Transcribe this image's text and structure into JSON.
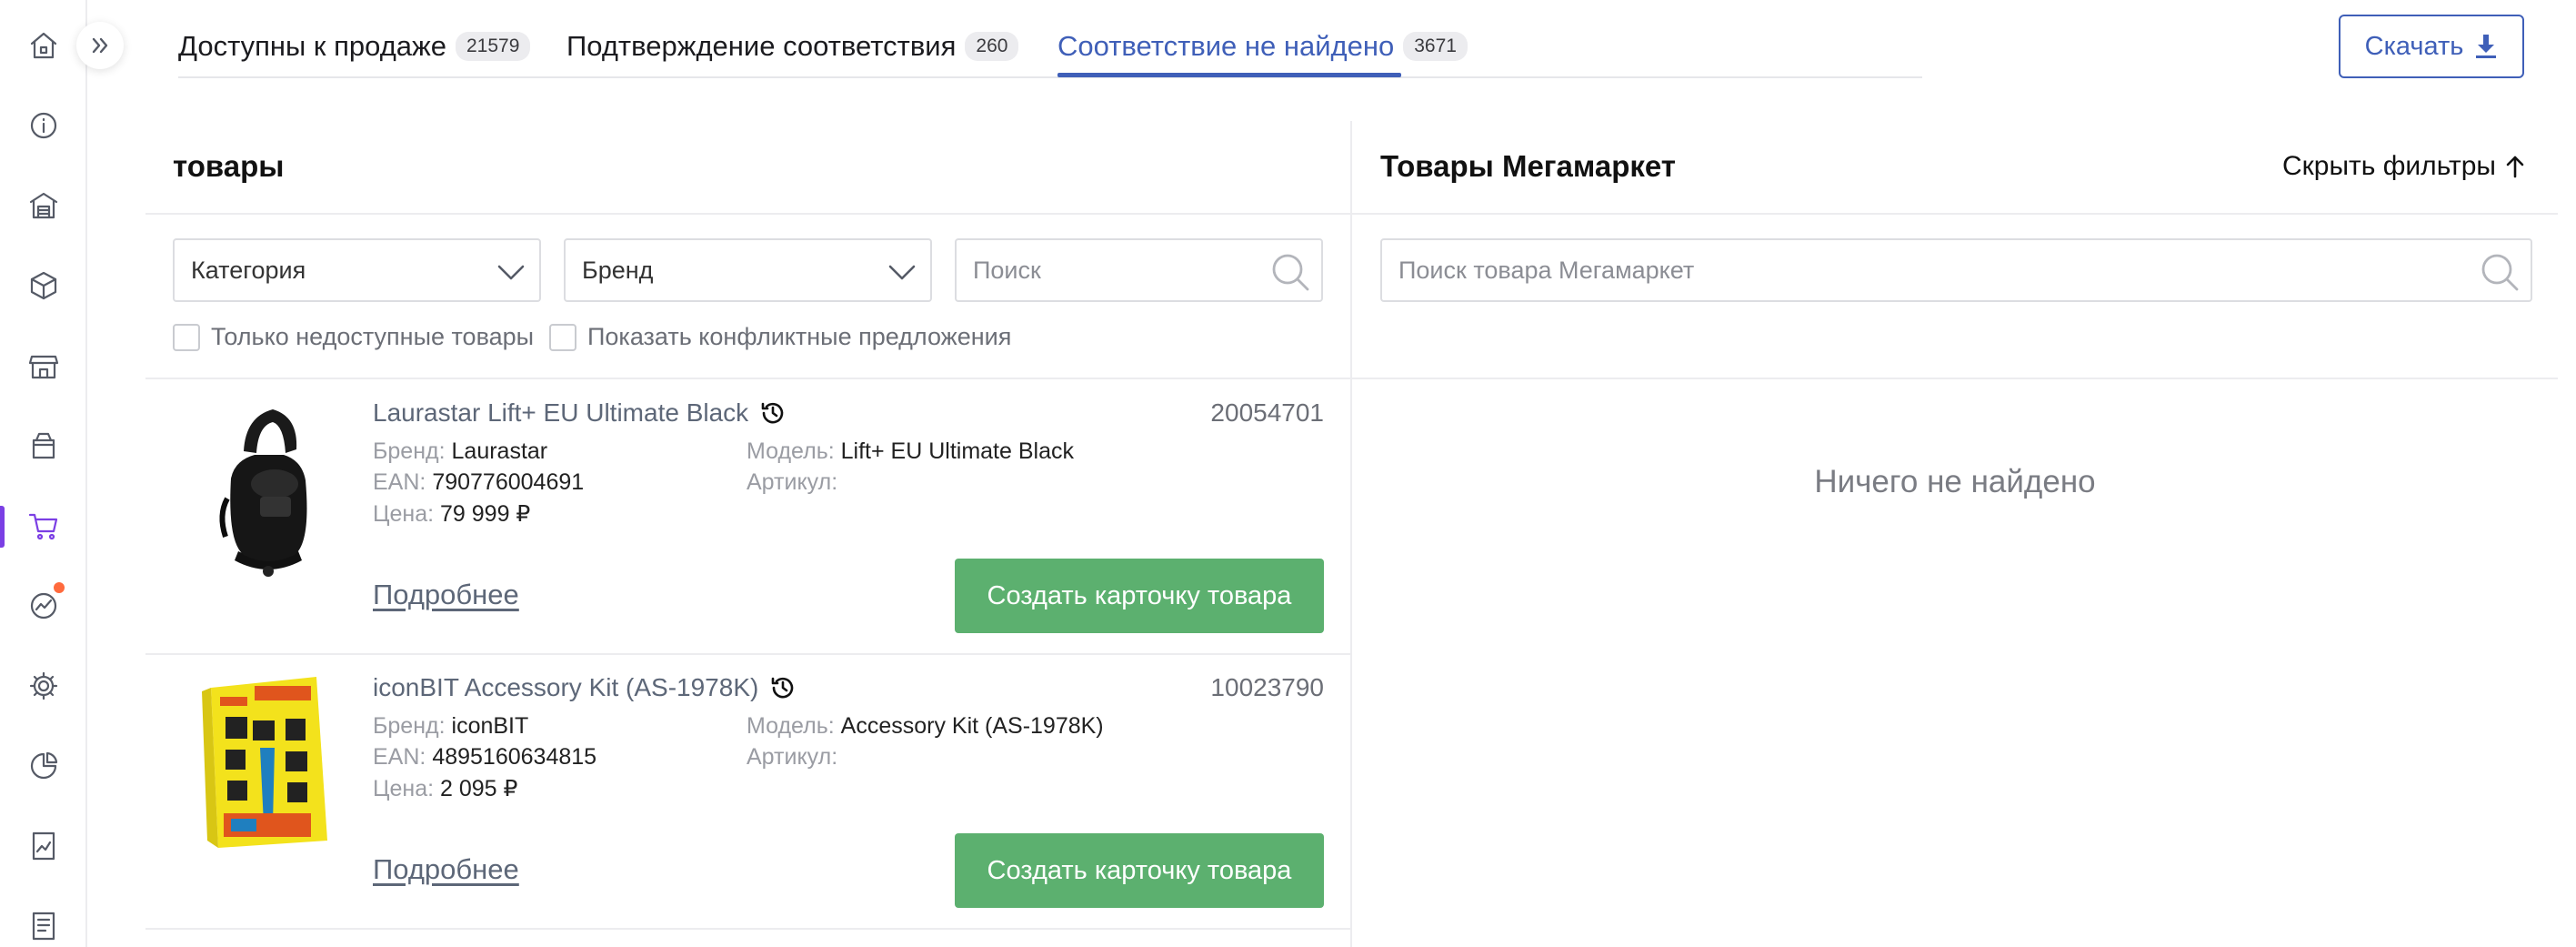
{
  "tabs": [
    {
      "label": "Доступны к продаже",
      "count": "21579"
    },
    {
      "label": "Подтверждение соответствия",
      "count": "260"
    },
    {
      "label": "Соответствие не найдено",
      "count": "3671"
    }
  ],
  "download": {
    "label": "Скачать",
    "icon": "download-icon"
  },
  "left_panel": {
    "title": "товары",
    "filters": {
      "category": "Категория",
      "brand": "Бренд",
      "search_placeholder": "Поиск",
      "checkbox_unavailable": "Только недоступные товары",
      "checkbox_conflicts": "Показать конфликтные предложения"
    }
  },
  "right_panel": {
    "title": "Товары Мегамаркет",
    "hide_filters": "Скрыть фильтры",
    "search_placeholder": "Поиск товара Мегамаркет",
    "empty": "Ничего не найдено"
  },
  "labels": {
    "brand": "Бренд:",
    "ean": "EAN:",
    "price": "Цена:",
    "model": "Модель:",
    "article": "Артикул:",
    "more": "Подробнее",
    "create": "Создать карточку товара"
  },
  "products": [
    {
      "name": "Laurastar Lift+ EU Ultimate Black",
      "id": "20054701",
      "brand": "Laurastar",
      "ean": "790776004691",
      "price": "79 999 ₽",
      "model": "Lift+ EU Ultimate Black",
      "article": ""
    },
    {
      "name": "iconBIT Accessory Kit (AS-1978K)",
      "id": "10023790",
      "brand": "iconBIT",
      "ean": "4895160634815",
      "price": "2 095 ₽",
      "model": "Accessory Kit (AS-1978K)",
      "article": ""
    }
  ],
  "colors": {
    "accent": "#3f5fb8",
    "active_nav": "#7b3fe4",
    "create_button": "#5cb06f",
    "notification_dot": "#ff6a3d"
  }
}
